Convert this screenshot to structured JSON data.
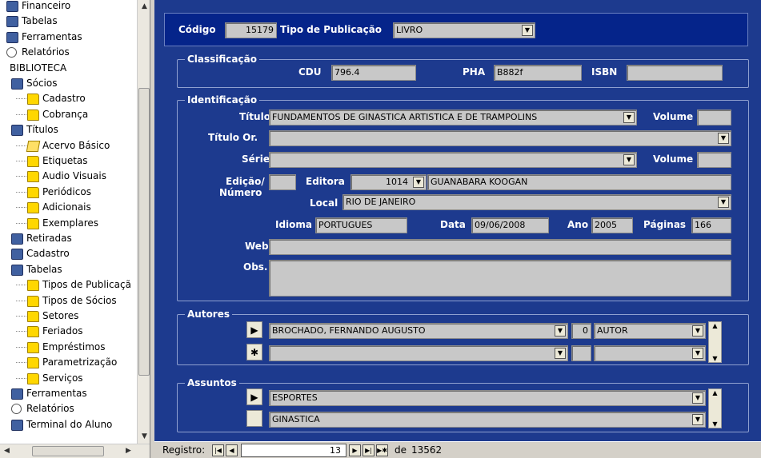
{
  "tree": {
    "items": [
      {
        "label": "Financeiro",
        "icon": "money-icon"
      },
      {
        "label": "Tabelas",
        "icon": "table-icon"
      },
      {
        "label": "Ferramentas",
        "icon": "tools-icon"
      },
      {
        "label": "Relatórios",
        "icon": "reports-icon"
      },
      {
        "label": "BIBLIOTECA"
      },
      {
        "label": "Sócios",
        "icon": "members-icon"
      },
      {
        "label": "Cadastro",
        "icon": "folder-icon"
      },
      {
        "label": "Cobrança",
        "icon": "folder-icon"
      },
      {
        "label": "Títulos",
        "icon": "books-icon"
      },
      {
        "label": "Acervo Básico",
        "icon": "open-folder-icon"
      },
      {
        "label": "Etiquetas",
        "icon": "folder-icon"
      },
      {
        "label": "Audio Visuais",
        "icon": "folder-icon"
      },
      {
        "label": "Periódicos",
        "icon": "folder-icon"
      },
      {
        "label": "Adicionais",
        "icon": "folder-icon"
      },
      {
        "label": "Exemplares",
        "icon": "folder-icon"
      },
      {
        "label": "Retiradas",
        "icon": "loans-icon"
      },
      {
        "label": "Cadastro",
        "icon": "register-icon"
      },
      {
        "label": "Tabelas",
        "icon": "table-icon"
      },
      {
        "label": "Tipos de Publicaçã",
        "icon": "folder-icon"
      },
      {
        "label": "Tipos de Sócios",
        "icon": "folder-icon"
      },
      {
        "label": "Setores",
        "icon": "folder-icon"
      },
      {
        "label": "Feriados",
        "icon": "folder-icon"
      },
      {
        "label": "Empréstimos",
        "icon": "folder-icon"
      },
      {
        "label": "Parametrização",
        "icon": "folder-icon"
      },
      {
        "label": "Serviços",
        "icon": "folder-icon"
      },
      {
        "label": "Ferramentas",
        "icon": "tools-icon"
      },
      {
        "label": "Relatórios",
        "icon": "reports-icon"
      },
      {
        "label": "Terminal do Aluno",
        "icon": "terminal-icon"
      }
    ]
  },
  "header": {
    "codigo_label": "Código",
    "codigo": "15179",
    "tipo_label": "Tipo de Publicação",
    "tipo": "LIVRO"
  },
  "classificacao": {
    "title": "Classificação",
    "cdu_label": "CDU",
    "cdu": "796.4",
    "pha_label": "PHA",
    "pha": "B882f",
    "isbn_label": "ISBN",
    "isbn": ""
  },
  "identificacao": {
    "title": "Identificação",
    "titulo_label": "Título",
    "titulo": "FUNDAMENTOS DE GINASTICA ARTISTICA E DE TRAMPOLINS",
    "volume_label": "Volume",
    "volume": "",
    "titulo_or_label": "Título Or.",
    "titulo_or": "",
    "serie_label": "Série",
    "serie": "",
    "volume2_label": "Volume",
    "volume2": "",
    "edicao_label": "Edição/",
    "numero_label": "Número",
    "edicao": "",
    "editora_label": "Editora",
    "editora_code": "1014",
    "editora_name": "GUANABARA KOOGAN",
    "local_label": "Local",
    "local": "RIO DE JANEIRO",
    "idioma_label": "Idioma",
    "idioma": "PORTUGUES",
    "data_label": "Data",
    "data": "09/06/2008",
    "ano_label": "Ano",
    "ano": "2005",
    "paginas_label": "Páginas",
    "paginas": "166",
    "web_label": "Web",
    "web": "",
    "obs_label": "Obs.",
    "obs": ""
  },
  "autores": {
    "title": "Autores",
    "rows": [
      {
        "name": "BROCHADO, FERNANDO AUGUSTO",
        "num": "0",
        "role": "AUTOR"
      },
      {
        "name": "",
        "num": "",
        "role": ""
      }
    ]
  },
  "assuntos": {
    "title": "Assuntos",
    "rows": [
      {
        "name": "ESPORTES"
      },
      {
        "name": "GINASTICA"
      }
    ]
  },
  "nav": {
    "registro_label": "Registro:",
    "current": "13",
    "de_label": "de",
    "total": "13562"
  }
}
